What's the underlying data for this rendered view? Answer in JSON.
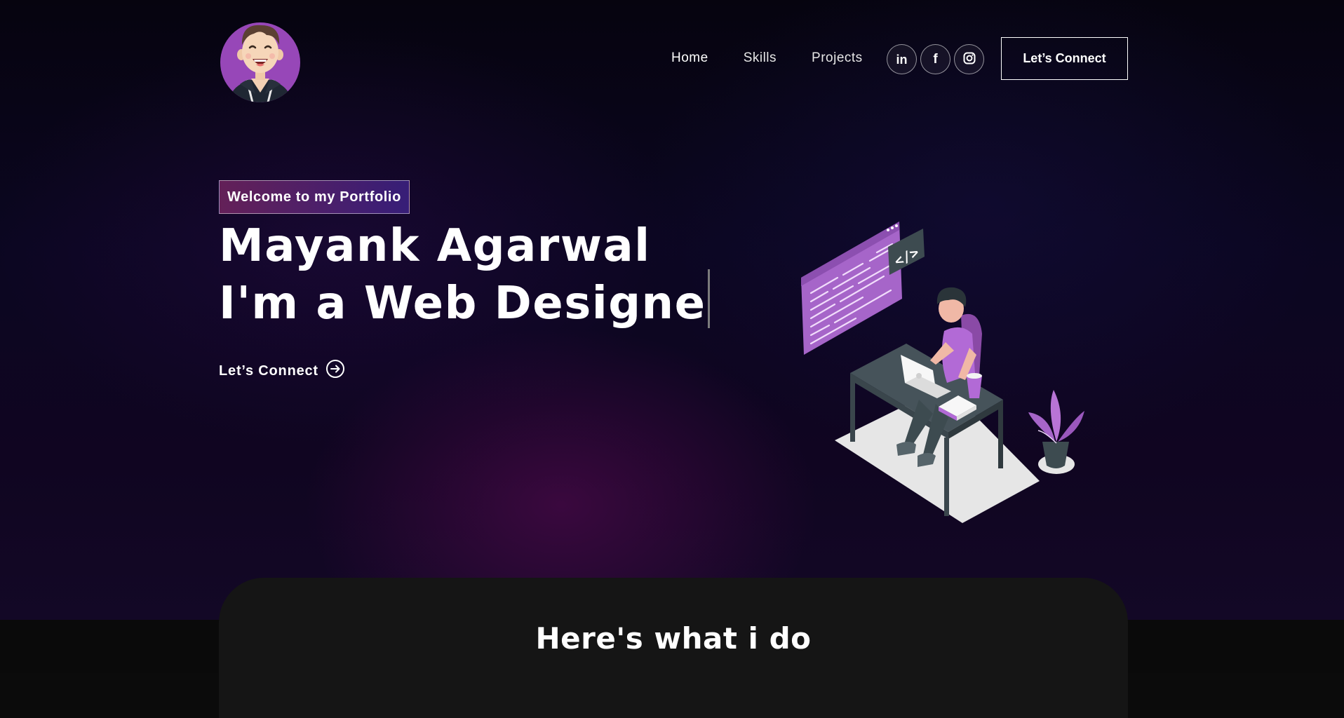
{
  "nav": {
    "logo_alt": "Mayank avatar",
    "links": [
      {
        "label": "Home",
        "active": true
      },
      {
        "label": "Skills",
        "active": false
      },
      {
        "label": "Projects",
        "active": false
      }
    ],
    "social": [
      {
        "icon": "linkedin-icon",
        "label": "in"
      },
      {
        "icon": "facebook-icon",
        "label": "f"
      },
      {
        "icon": "instagram-icon",
        "label": ""
      }
    ],
    "connect_button": "Let’s Connect"
  },
  "hero": {
    "tagline": "Welcome to my Portfolio",
    "name": "Mayank Agarwal",
    "typed_text": "I'm a Web Designe",
    "cta_label": "Let’s Connect",
    "cta_icon": "arrow-right-circle-icon"
  },
  "services": {
    "title": "Here's what i do"
  },
  "colors": {
    "accent_purple": "#9b59b6",
    "tag_gradient_start": "#aa367c",
    "tag_gradient_end": "#4a2fbd",
    "background": "#0b0621",
    "card": "#151515"
  }
}
